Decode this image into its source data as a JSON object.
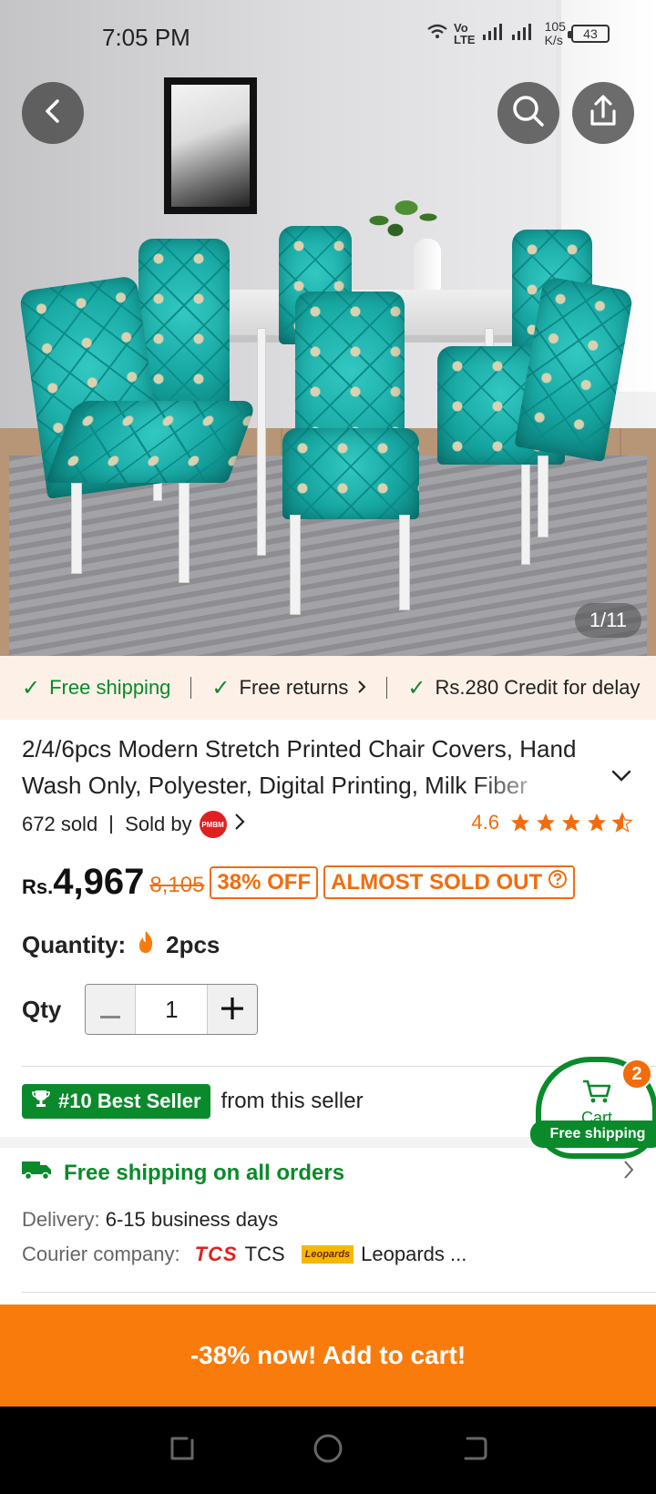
{
  "status_bar": {
    "time": "7:05 PM",
    "network_top": "Vo",
    "network_bottom": "LTE",
    "speed_top": "105",
    "speed_bottom": "K/s",
    "battery": "43"
  },
  "gallery": {
    "counter": "1/11",
    "icons": [
      "back-arrow-icon",
      "search-icon",
      "share-icon"
    ]
  },
  "promo": {
    "item1": "Free shipping",
    "item2": "Free returns",
    "item3": "Rs.280 Credit for delay"
  },
  "product": {
    "title": "2/4/6pcs Modern Stretch Printed Chair Covers, Hand Wash Only, Polyester, Digital Printing, Milk Fiber",
    "sold": "672 sold",
    "sold_by": "Sold by",
    "seller_logo": "PMBM",
    "rating": "4.6",
    "currency": "Rs.",
    "price": "4,967",
    "old_price": "8,105",
    "discount_tag": "38% OFF",
    "stock_tag": "ALMOST SOLD OUT"
  },
  "quantity": {
    "label": "Quantity:",
    "value": "2pcs",
    "qty_label": "Qty",
    "qty_value": "1"
  },
  "best_seller": {
    "badge": "#10 Best Seller",
    "text": "from this seller"
  },
  "shipping": {
    "title": "Free shipping on all orders",
    "delivery_label": "Delivery:",
    "delivery_value": "6-15 business days",
    "courier_label": "Courier company:",
    "courier1_logo": "TCS",
    "courier1": "TCS",
    "courier2_logo": "Leopards",
    "courier2": "Leopards ..."
  },
  "cart": {
    "label": "Cart",
    "count": "2",
    "ship_label": "Free shipping"
  },
  "cta": {
    "label": "-38% now! Add to cart!"
  },
  "colors": {
    "accent_orange": "#f97b0c",
    "price_orange": "#f26c0d",
    "green": "#0a8a2a",
    "promo_bg": "#fdf1e7"
  }
}
